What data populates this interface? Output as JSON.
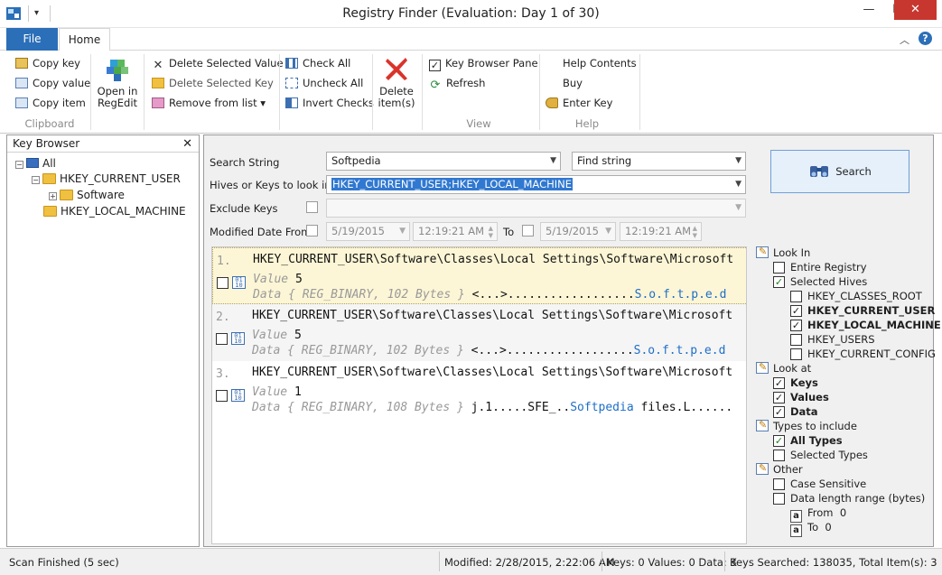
{
  "window": {
    "title": "Registry Finder (Evaluation: Day 1 of 30)",
    "minimize": "—",
    "maximize": "☐",
    "close": "✕"
  },
  "ribbon": {
    "tabs": [
      "File",
      "Home"
    ],
    "clipboard": {
      "items": [
        "Copy key",
        "Copy value",
        "Copy item"
      ],
      "label": "Clipboard"
    },
    "open_regedit": [
      "Open in",
      "RegEdit"
    ],
    "delete_group": [
      "Delete Selected Value",
      "Delete Selected Key",
      "Remove from list ▾"
    ],
    "check_group": [
      "Check All",
      "Uncheck All",
      "Invert Checks"
    ],
    "delete_items": [
      "Delete",
      "item(s)"
    ],
    "view": {
      "items": [
        "Key Browser Pane",
        "Refresh"
      ],
      "label": "View"
    },
    "help": {
      "items": [
        "Help Contents",
        "Buy",
        "Enter Key"
      ],
      "label": "Help"
    }
  },
  "key_browser": {
    "title": "Key Browser",
    "tree": {
      "root": "All",
      "hkcu": "HKEY_CURRENT_USER",
      "software": "Software",
      "hklm": "HKEY_LOCAL_MACHINE"
    }
  },
  "search": {
    "search_string_label": "Search String",
    "search_string_value": "Softpedia",
    "find_mode": "Find string",
    "hives_label": "Hives or Keys to look in",
    "hives_value": "HKEY_CURRENT_USER;HKEY_LOCAL_MACHINE",
    "exclude_label": "Exclude Keys",
    "modified_from_label": "Modified Date From",
    "from_date": "5/19/2015",
    "from_time": "12:19:21 AM",
    "to_label": "To",
    "to_date": "5/19/2015",
    "to_time": "12:19:21 AM",
    "search_button": "Search"
  },
  "results": [
    {
      "num": "1.",
      "path": "HKEY_CURRENT_USER\\Software\\Classes\\Local Settings\\Software\\Microsoft",
      "value_label": "Value",
      "value": "5",
      "data_label": "Data",
      "data_type": "{ REG_BINARY, 102 Bytes }",
      "data_plain": "<...>..................",
      "data_hit": "S.o.f.t.p.e.d"
    },
    {
      "num": "2.",
      "path": "HKEY_CURRENT_USER\\Software\\Classes\\Local Settings\\Software\\Microsoft",
      "value_label": "Value",
      "value": "5",
      "data_label": "Data",
      "data_type": "{ REG_BINARY, 102 Bytes }",
      "data_plain": "<...>..................",
      "data_hit": "S.o.f.t.p.e.d"
    },
    {
      "num": "3.",
      "path": "HKEY_CURRENT_USER\\Software\\Classes\\Local Settings\\Software\\Microsoft",
      "value_label": "Value",
      "value": "1",
      "data_label": "Data",
      "data_type": "{ REG_BINARY, 108 Bytes }",
      "data_plain": "j.1.....SFE_..",
      "data_hit": "Softpedia",
      "data_tail": " files.L......"
    }
  ],
  "options": {
    "look_in": "Look In",
    "entire_registry": "Entire Registry",
    "selected_hives": "Selected Hives",
    "hives": [
      "HKEY_CLASSES_ROOT",
      "HKEY_CURRENT_USER",
      "HKEY_LOCAL_MACHINE",
      "HKEY_USERS",
      "HKEY_CURRENT_CONFIG"
    ],
    "look_at": "Look at",
    "look_at_items": [
      "Keys",
      "Values",
      "Data"
    ],
    "types_to_include": "Types to include",
    "all_types": "All Types",
    "selected_types": "Selected Types",
    "other": "Other",
    "case_sensitive": "Case Sensitive",
    "data_length_range": "Data length range (bytes)",
    "from_label": "From",
    "from_value": "0",
    "to_label": "To",
    "to_value": "0"
  },
  "status": {
    "scan": "Scan Finished (5 sec)",
    "modified": "Modified: 2/28/2015, 2:22:06 AM",
    "counts": "Keys: 0 Values: 0 Data: 3",
    "searched": "Keys Searched: 138035, Total Item(s): 3"
  },
  "colors": {
    "file_tab": "#2b6fb8",
    "selection": "#3078d0",
    "highlight_row": "#fdf6d6",
    "hit_text": "#1e6ec8"
  }
}
